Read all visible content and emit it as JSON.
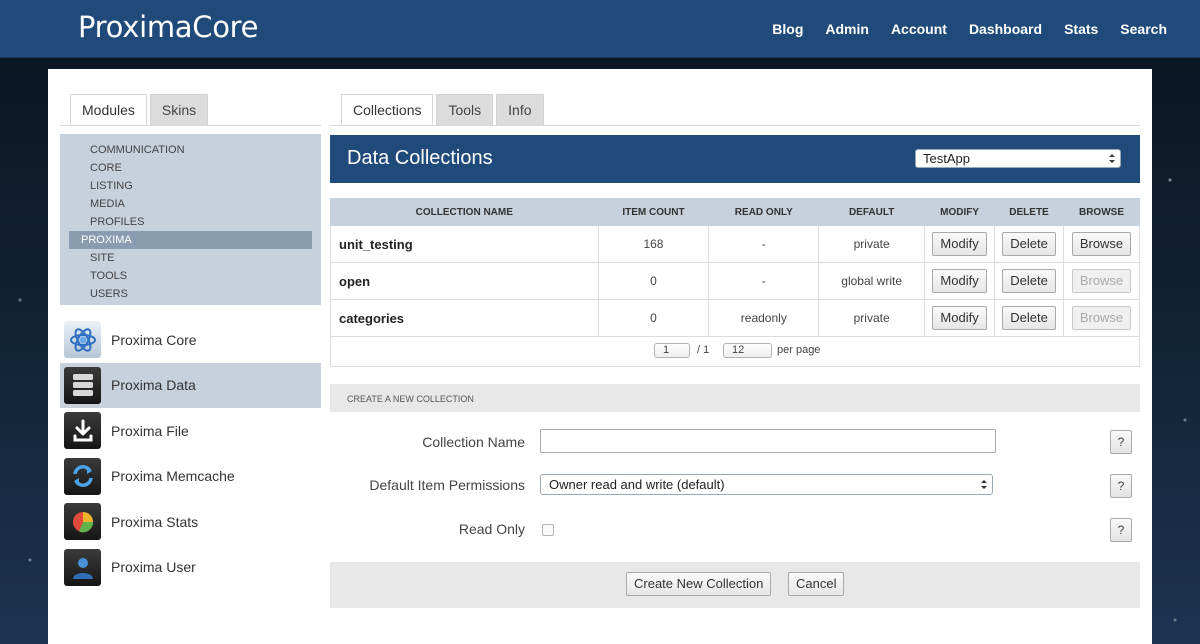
{
  "brand": "ProximaCore",
  "nav": [
    "Blog",
    "Admin",
    "Account",
    "Dashboard",
    "Stats",
    "Search"
  ],
  "left_tabs": [
    "Modules",
    "Skins"
  ],
  "categories": [
    "COMMUNICATION",
    "CORE",
    "LISTING",
    "MEDIA",
    "PROFILES",
    "PROXIMA",
    "SITE",
    "TOOLS",
    "USERS"
  ],
  "modules": [
    "Proxima Core",
    "Proxima Data",
    "Proxima File",
    "Proxima Memcache",
    "Proxima Stats",
    "Proxima User"
  ],
  "right_tabs": [
    "Collections",
    "Tools",
    "Info"
  ],
  "header": {
    "title": "Data Collections",
    "app_select": "TestApp"
  },
  "table": {
    "headers": [
      "COLLECTION NAME",
      "ITEM COUNT",
      "READ ONLY",
      "DEFAULT",
      "MODIFY",
      "DELETE",
      "BROWSE"
    ],
    "rows": [
      {
        "name": "unit_testing",
        "count": "168",
        "readonly": "-",
        "default": "private",
        "modify": "Modify",
        "delete": "Delete",
        "browse": "Browse"
      },
      {
        "name": "open",
        "count": "0",
        "readonly": "-",
        "default": "global write",
        "modify": "Modify",
        "delete": "Delete",
        "browse": "Browse"
      },
      {
        "name": "categories",
        "count": "0",
        "readonly": "readonly",
        "default": "private",
        "modify": "Modify",
        "delete": "Delete",
        "browse": "Browse"
      }
    ]
  },
  "pager": {
    "page": "1",
    "of": "/ 1",
    "per_page_value": "12",
    "per_page_label": "per page"
  },
  "create": {
    "title": "CREATE A NEW COLLECTION",
    "name_label": "Collection Name",
    "name_value": "",
    "perm_label": "Default Item Permissions",
    "perm_value": "Owner read and write (default)",
    "readonly_label": "Read Only",
    "help": "?",
    "create_btn": "Create New Collection",
    "cancel_btn": "Cancel"
  }
}
